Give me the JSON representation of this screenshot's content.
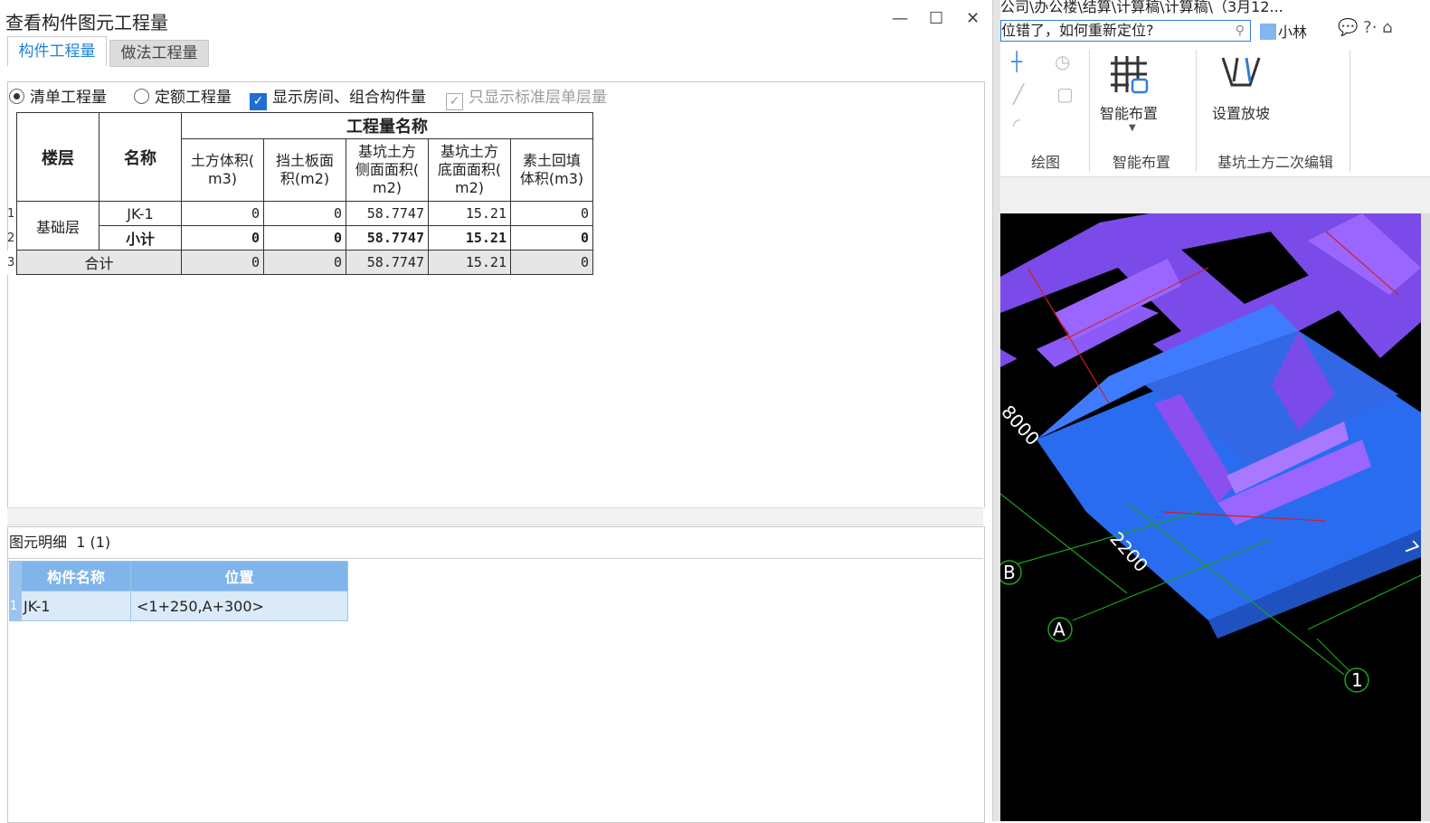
{
  "dialog": {
    "title": "查看构件图元工程量",
    "buttons": {
      "minimize": "—",
      "maximize": "☐",
      "close": "✕"
    },
    "tabs": [
      {
        "label": "构件工程量",
        "active": true
      },
      {
        "label": "做法工程量",
        "active": false
      }
    ],
    "options": {
      "radio_list_qty": "清单工程量",
      "radio_quota_qty": "定额工程量",
      "check_show_rooms": "显示房间、组合构件量",
      "check_std_floor": "只显示标准层单层量"
    },
    "qty_table": {
      "col_floor": "楼层",
      "col_name": "名称",
      "group_header": "工程量名称",
      "sub_cols": [
        [
          "土方体积(",
          "m3)"
        ],
        [
          "挡土板面",
          "积(m2)"
        ],
        [
          "基坑土方",
          "侧面面积(",
          "m2)"
        ],
        [
          "基坑土方",
          "底面面积(",
          "m2)"
        ],
        [
          "素土回填",
          "体积(m3)"
        ]
      ],
      "rows": [
        {
          "no": "1",
          "floor": "基础层",
          "name": "JK-1",
          "values": [
            "0",
            "0",
            "58.7747",
            "15.21",
            "0"
          ]
        },
        {
          "no": "2",
          "name": "小计",
          "values": [
            "0",
            "0",
            "58.7747",
            "15.21",
            "0"
          ]
        },
        {
          "no": "3",
          "name": "合计",
          "values": [
            "0",
            "0",
            "58.7747",
            "15.21",
            "0"
          ]
        }
      ]
    },
    "detail": {
      "title": "图元明细",
      "count": "1 (1)",
      "columns": [
        "构件名称",
        "位置"
      ],
      "rows": [
        {
          "no": "1",
          "name": "JK-1",
          "position": "<1+250,A+300>"
        }
      ]
    }
  },
  "app": {
    "path": "公司\\办公楼\\结算\\计算稿\\计算稿\\（3月12...",
    "search_placeholder": "位错了，如何重新定位?",
    "user": "小林",
    "help": "?·",
    "ribbon": {
      "smart_layout_btn": "智能布置",
      "slope_btn": "设置放坡",
      "groups": [
        "绘图",
        "智能布置",
        "基坑土方二次编辑"
      ]
    },
    "canvas": {
      "dims": [
        "8000",
        "2200",
        "7"
      ],
      "axes": [
        "B",
        "A",
        "1"
      ]
    }
  },
  "colors": {
    "accent": "#1e7fd6",
    "table_header_bg": "#7fb5ea",
    "canvas_bg": "#000000",
    "pit_blue": "#2a6cf0",
    "beam_purple": "#8b4ff0"
  }
}
